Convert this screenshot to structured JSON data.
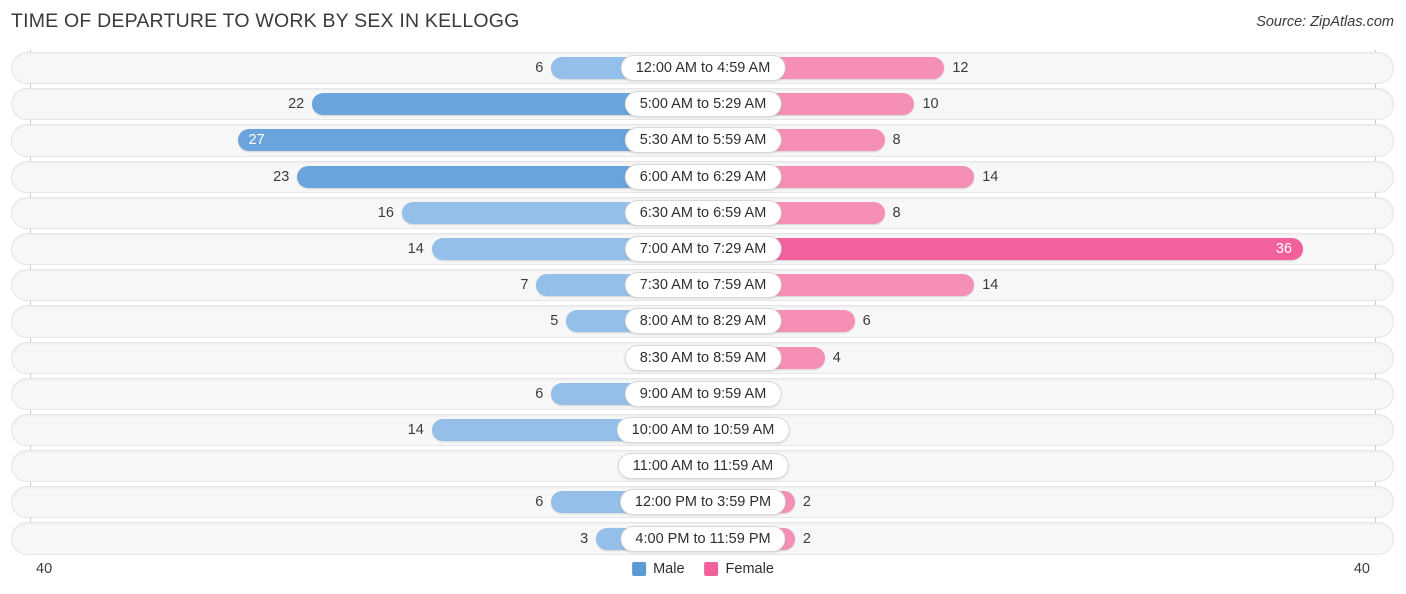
{
  "header": {
    "title": "TIME OF DEPARTURE TO WORK BY SEX IN KELLOGG",
    "source": "Source: ZipAtlas.com"
  },
  "legend": {
    "male_label": "Male",
    "female_label": "Female",
    "male_color": "#5B9BD5",
    "female_color": "#F2609E"
  },
  "axis": {
    "left_max": "40",
    "right_max": "40",
    "max_value": 40
  },
  "colors": {
    "male_light": "#93BFE8",
    "male_dark": "#6BA3DC",
    "female_light": "#F58FB6",
    "female_dark": "#F2609E",
    "track": "#f7f7f7",
    "track_border": "#e6e6e6"
  },
  "chart_data": {
    "type": "bar",
    "title": "TIME OF DEPARTURE TO WORK BY SEX IN KELLOGG",
    "orientation": "horizontal-diverging",
    "xlabel": "",
    "ylabel": "",
    "xlim": [
      40,
      40
    ],
    "grid": false,
    "legend_position": "bottom-center",
    "categories": [
      "12:00 AM to 4:59 AM",
      "5:00 AM to 5:29 AM",
      "5:30 AM to 5:59 AM",
      "6:00 AM to 6:29 AM",
      "6:30 AM to 6:59 AM",
      "7:00 AM to 7:29 AM",
      "7:30 AM to 7:59 AM",
      "8:00 AM to 8:29 AM",
      "8:30 AM to 8:59 AM",
      "9:00 AM to 9:59 AM",
      "10:00 AM to 10:59 AM",
      "11:00 AM to 11:59 AM",
      "12:00 PM to 3:59 PM",
      "4:00 PM to 11:59 PM"
    ],
    "series": [
      {
        "name": "Male",
        "values": [
          6,
          22,
          27,
          23,
          16,
          14,
          7,
          5,
          0,
          6,
          14,
          0,
          6,
          3
        ]
      },
      {
        "name": "Female",
        "values": [
          12,
          10,
          8,
          14,
          8,
          36,
          14,
          6,
          4,
          0,
          0,
          0,
          2,
          2
        ]
      }
    ]
  },
  "rows": [
    {
      "category": "12:00 AM to 4:59 AM",
      "male": "6",
      "female": "12"
    },
    {
      "category": "5:00 AM to 5:29 AM",
      "male": "22",
      "female": "10"
    },
    {
      "category": "5:30 AM to 5:59 AM",
      "male": "27",
      "female": "8"
    },
    {
      "category": "6:00 AM to 6:29 AM",
      "male": "23",
      "female": "14"
    },
    {
      "category": "6:30 AM to 6:59 AM",
      "male": "16",
      "female": "8"
    },
    {
      "category": "7:00 AM to 7:29 AM",
      "male": "14",
      "female": "36"
    },
    {
      "category": "7:30 AM to 7:59 AM",
      "male": "7",
      "female": "14"
    },
    {
      "category": "8:00 AM to 8:29 AM",
      "male": "5",
      "female": "6"
    },
    {
      "category": "8:30 AM to 8:59 AM",
      "male": "0",
      "female": "4"
    },
    {
      "category": "9:00 AM to 9:59 AM",
      "male": "6",
      "female": "0"
    },
    {
      "category": "10:00 AM to 10:59 AM",
      "male": "14",
      "female": "0"
    },
    {
      "category": "11:00 AM to 11:59 AM",
      "male": "0",
      "female": "0"
    },
    {
      "category": "12:00 PM to 3:59 PM",
      "male": "6",
      "female": "2"
    },
    {
      "category": "4:00 PM to 11:59 PM",
      "male": "3",
      "female": "2"
    }
  ]
}
